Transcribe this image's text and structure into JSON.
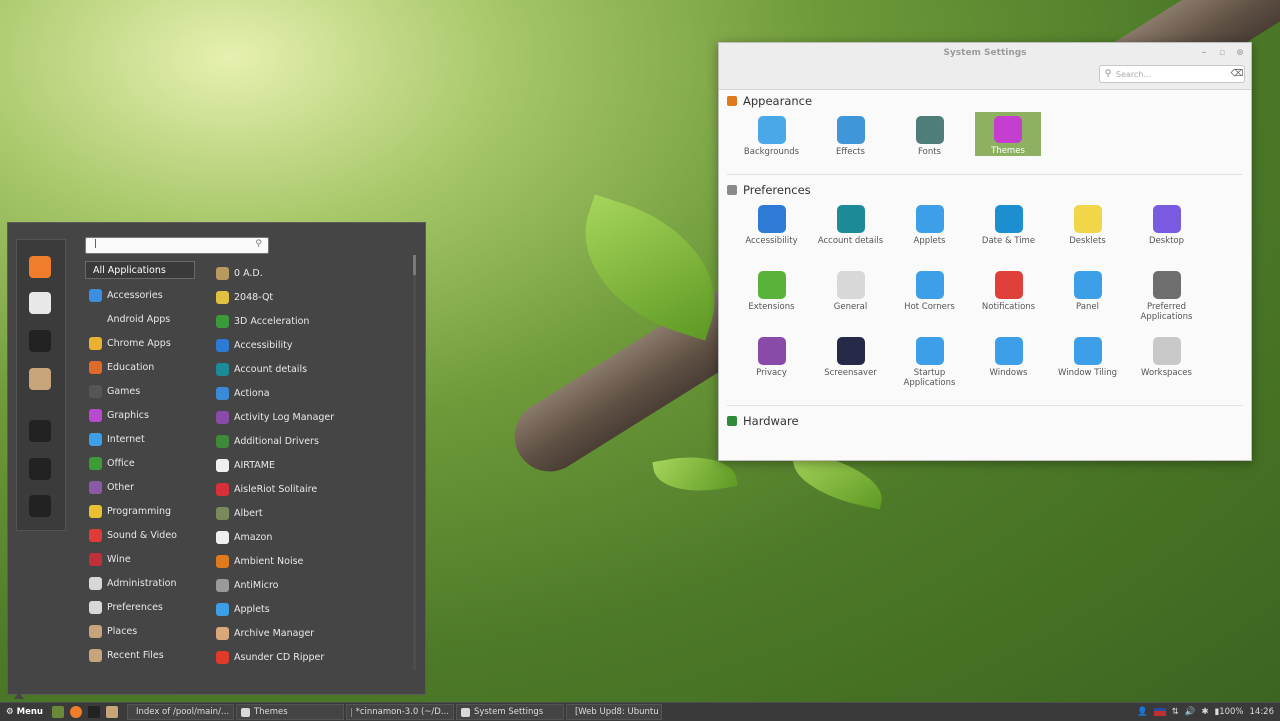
{
  "settings_window": {
    "title": "System Settings",
    "search_placeholder": "Search...",
    "sections": [
      {
        "title": "Appearance",
        "color": "#e07a1f",
        "items": [
          {
            "label": "Backgrounds",
            "icon": "backgrounds-icon",
            "color": "#4aa8e8"
          },
          {
            "label": "Effects",
            "icon": "effects-icon",
            "color": "#3f96d8"
          },
          {
            "label": "Fonts",
            "icon": "fonts-icon",
            "color": "#4f7d78"
          },
          {
            "label": "Themes",
            "icon": "themes-icon",
            "color": "#c43fd0",
            "selected": true
          }
        ]
      },
      {
        "title": "Preferences",
        "color": "#8a8a8a",
        "items": [
          {
            "label": "Accessibility",
            "icon": "accessibility-icon",
            "color": "#2d7bd4"
          },
          {
            "label": "Account details",
            "icon": "account-details-icon",
            "color": "#1d8a98"
          },
          {
            "label": "Applets",
            "icon": "applets-icon",
            "color": "#3d9fe8"
          },
          {
            "label": "Date & Time",
            "icon": "date-time-icon",
            "color": "#1b8fd0"
          },
          {
            "label": "Desklets",
            "icon": "desklets-icon",
            "color": "#f1d64a"
          },
          {
            "label": "Desktop",
            "icon": "desktop-icon",
            "color": "#7a5ae0"
          },
          {
            "label": "Extensions",
            "icon": "extensions-icon",
            "color": "#59b33a"
          },
          {
            "label": "General",
            "icon": "general-icon",
            "color": "#d8d8d8"
          },
          {
            "label": "Hot Corners",
            "icon": "hot-corners-icon",
            "color": "#3d9fe8"
          },
          {
            "label": "Notifications",
            "icon": "notifications-icon",
            "color": "#e0403a"
          },
          {
            "label": "Panel",
            "icon": "panel-icon",
            "color": "#3d9fe8"
          },
          {
            "label": "Preferred Applications",
            "icon": "preferred-applications-icon",
            "color": "#6e6e6e"
          },
          {
            "label": "Privacy",
            "icon": "privacy-icon",
            "color": "#8a4aa8"
          },
          {
            "label": "Screensaver",
            "icon": "screensaver-icon",
            "color": "#262a48"
          },
          {
            "label": "Startup Applications",
            "icon": "startup-applications-icon",
            "color": "#3d9fe8"
          },
          {
            "label": "Windows",
            "icon": "windows-icon",
            "color": "#3d9fe8"
          },
          {
            "label": "Window Tiling",
            "icon": "window-tiling-icon",
            "color": "#3d9fe8"
          },
          {
            "label": "Workspaces",
            "icon": "workspaces-icon",
            "color": "#c8c8c8"
          }
        ]
      },
      {
        "title": "Hardware",
        "color": "#2f8a3a",
        "items": []
      }
    ]
  },
  "start_menu": {
    "search_value": "|",
    "favorites": [
      {
        "name": "firefox-icon",
        "color": "#f07d2a"
      },
      {
        "name": "settings-toggle-icon",
        "color": "#e8e8e8"
      },
      {
        "name": "terminal-icon",
        "color": "#222222"
      },
      {
        "name": "folder-icon",
        "color": "#c8a47a"
      },
      {
        "name": "lock-icon",
        "color": "#222222"
      },
      {
        "name": "logout-icon",
        "color": "#222222"
      },
      {
        "name": "power-icon",
        "color": "#222222"
      }
    ],
    "categories": [
      {
        "label": "All Applications",
        "selected": true
      },
      {
        "label": "Accessories",
        "icon": "accessories-icon",
        "color": "#3a8fe0"
      },
      {
        "label": "Android Apps",
        "icon": "",
        "color": ""
      },
      {
        "label": "Chrome Apps",
        "icon": "chrome-icon",
        "color": "#e8b230"
      },
      {
        "label": "Education",
        "icon": "education-icon",
        "color": "#e06a2a"
      },
      {
        "label": "Games",
        "icon": "games-icon",
        "color": "#555555"
      },
      {
        "label": "Graphics",
        "icon": "graphics-icon",
        "color": "#b84ad0"
      },
      {
        "label": "Internet",
        "icon": "internet-icon",
        "color": "#3d9fe8"
      },
      {
        "label": "Office",
        "icon": "office-icon",
        "color": "#3f9a3a"
      },
      {
        "label": "Other",
        "icon": "other-icon",
        "color": "#8a5aa8"
      },
      {
        "label": "Programming",
        "icon": "programming-icon",
        "color": "#e8c030"
      },
      {
        "label": "Sound & Video",
        "icon": "sound-video-icon",
        "color": "#e03a3a"
      },
      {
        "label": "Wine",
        "icon": "wine-icon",
        "color": "#c0303a"
      },
      {
        "label": "Administration",
        "icon": "administration-icon",
        "color": "#d8d8d8"
      },
      {
        "label": "Preferences",
        "icon": "preferences-icon",
        "color": "#d8d8d8"
      },
      {
        "label": "Places",
        "icon": "places-icon",
        "color": "#c8a47a"
      },
      {
        "label": "Recent Files",
        "icon": "recent-files-icon",
        "color": "#c8a47a"
      }
    ],
    "apps": [
      {
        "label": "0 A.D.",
        "icon": "0ad-icon",
        "color": "#b89a60"
      },
      {
        "label": "2048-Qt",
        "icon": "2048-icon",
        "color": "#e0c040"
      },
      {
        "label": "3D Acceleration",
        "icon": "3d-acceleration-icon",
        "color": "#3a9a3a"
      },
      {
        "label": "Accessibility",
        "icon": "accessibility-icon",
        "color": "#2d7bd4"
      },
      {
        "label": "Account details",
        "icon": "account-details-icon",
        "color": "#1d8a98"
      },
      {
        "label": "Actiona",
        "icon": "actiona-icon",
        "color": "#3a8ad8"
      },
      {
        "label": "Activity Log Manager",
        "icon": "activity-log-icon",
        "color": "#8a4aa8"
      },
      {
        "label": "Additional Drivers",
        "icon": "additional-drivers-icon",
        "color": "#3f8a3a"
      },
      {
        "label": "AIRTAME",
        "icon": "airtame-icon",
        "color": "#f0f0f0"
      },
      {
        "label": "AisleRiot Solitaire",
        "icon": "aisleriot-icon",
        "color": "#d8303a"
      },
      {
        "label": "Albert",
        "icon": "albert-icon",
        "color": "#7a8a5a"
      },
      {
        "label": "Amazon",
        "icon": "amazon-icon",
        "color": "#f0f0f0"
      },
      {
        "label": "Ambient Noise",
        "icon": "ambient-noise-icon",
        "color": "#e07a1f"
      },
      {
        "label": "AntiMicro",
        "icon": "antimicro-icon",
        "color": "#999999"
      },
      {
        "label": "Applets",
        "icon": "applets-icon",
        "color": "#3d9fe8"
      },
      {
        "label": "Archive Manager",
        "icon": "archive-manager-icon",
        "color": "#d8a87a"
      },
      {
        "label": "Asunder CD Ripper",
        "icon": "asunder-icon",
        "color": "#e03a2a"
      }
    ]
  },
  "panel": {
    "menu_label": "Menu",
    "tasks": [
      {
        "label": "Index of /pool/main/...",
        "color": "#c0303a"
      },
      {
        "label": "Themes",
        "color": "#d8d8d8"
      },
      {
        "label": "*cinnamon-3.0 (~/D...",
        "color": "#8a7ad8"
      },
      {
        "label": "System Settings",
        "color": "#d8d8d8"
      },
      {
        "label": "[Web Upd8: Ubuntu ...",
        "color": "#f07d2a"
      }
    ],
    "battery": "100%",
    "clock": "14:26"
  }
}
